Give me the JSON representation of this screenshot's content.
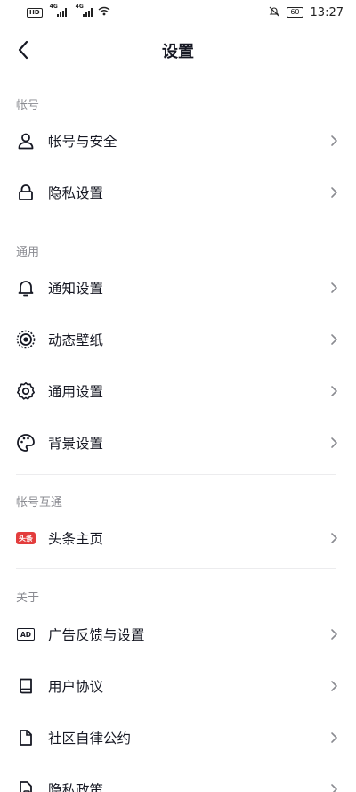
{
  "status_bar": {
    "hd": "HD",
    "net1": "4G",
    "net2": "4G",
    "battery": "60",
    "time": "13:27"
  },
  "header": {
    "title": "设置"
  },
  "sections": {
    "account": {
      "label": "帐号",
      "items": [
        {
          "label": "帐号与安全",
          "icon": "user-icon"
        },
        {
          "label": "隐私设置",
          "icon": "lock-icon"
        }
      ]
    },
    "general": {
      "label": "通用",
      "items": [
        {
          "label": "通知设置",
          "icon": "bell-icon"
        },
        {
          "label": "动态壁纸",
          "icon": "live-wallpaper-icon"
        },
        {
          "label": "通用设置",
          "icon": "gear-icon"
        },
        {
          "label": "背景设置",
          "icon": "palette-icon"
        }
      ]
    },
    "linked": {
      "label": "帐号互通",
      "items": [
        {
          "label": "头条主页",
          "icon": "toutiao-icon",
          "badge": "头条"
        }
      ]
    },
    "about": {
      "label": "关于",
      "items": [
        {
          "label": "广告反馈与设置",
          "icon": "ad-icon",
          "badge": "AD"
        },
        {
          "label": "用户协议",
          "icon": "book-icon"
        },
        {
          "label": "社区自律公约",
          "icon": "document-icon"
        },
        {
          "label": "隐私政策",
          "icon": "privacy-doc-icon"
        }
      ]
    }
  }
}
